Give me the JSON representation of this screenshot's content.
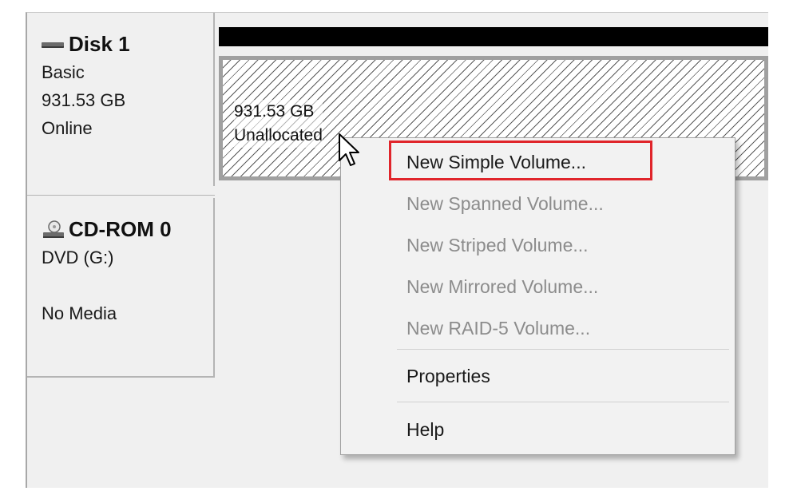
{
  "disks": [
    {
      "name": "Disk 1",
      "type": "Basic",
      "size": "931.53 GB",
      "status": "Online",
      "icon": "hard-disk-icon",
      "volume": {
        "size": "931.53 GB",
        "state": "Unallocated"
      }
    },
    {
      "name": "CD-ROM 0",
      "type": "DVD (G:)",
      "status": "No Media",
      "icon": "cd-rom-icon"
    }
  ],
  "context_menu": {
    "items": [
      {
        "label": "New Simple Volume...",
        "enabled": true,
        "highlighted": true
      },
      {
        "label": "New Spanned Volume...",
        "enabled": false
      },
      {
        "label": "New Striped Volume...",
        "enabled": false
      },
      {
        "label": "New Mirrored Volume...",
        "enabled": false
      },
      {
        "label": "New RAID-5 Volume...",
        "enabled": false
      },
      {
        "label": "Properties",
        "enabled": true
      },
      {
        "label": "Help",
        "enabled": true
      }
    ]
  },
  "colors": {
    "highlight_border": "#e0252b",
    "disabled_text": "#8c8c8c",
    "disk_bar": "#000000"
  }
}
